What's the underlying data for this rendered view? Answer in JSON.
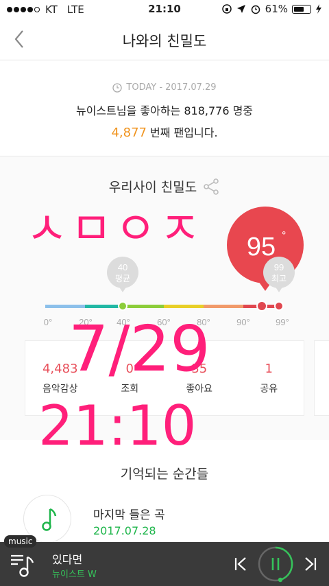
{
  "status_bar": {
    "carrier": "KT",
    "network": "LTE",
    "time": "21:10",
    "battery": "61%"
  },
  "nav": {
    "title": "나와의 친밀도"
  },
  "today": {
    "date_label": "TODAY - 2017.07.29",
    "line1": "뉴이스트님을 좋아하는 818,776 명중",
    "rank": "4,877",
    "rank_suffix": " 번째 팬입니다."
  },
  "intimacy": {
    "heading": "우리사이 친밀도",
    "my_score": "95",
    "my_score_degree": "°",
    "average": {
      "value": "40",
      "label": "평균"
    },
    "highest": {
      "value": "99",
      "label": "최고"
    },
    "scale_ticks": [
      "0°",
      "20°",
      "40°",
      "60°",
      "80°",
      "90°",
      "99°"
    ],
    "segment_colors": [
      "#8cc0ea",
      "#22b8a4",
      "#8ccd3a",
      "#e8cf27",
      "#f19a6a",
      "#e0474f"
    ],
    "stats": [
      {
        "value": "4,483",
        "label": "음악감상"
      },
      {
        "value": "0",
        "label": "조회"
      },
      {
        "value": "35",
        "label": "좋아요"
      },
      {
        "value": "1",
        "label": "공유"
      }
    ]
  },
  "moments": {
    "heading": "기억되는 순간들",
    "item_title": "마지막 들은 곡",
    "item_date": "2017.07.28"
  },
  "player": {
    "tag": "music",
    "song": "있다면",
    "artist": "뉴이스트 W"
  },
  "handwriting": {
    "line1": "ㅅㅁㅇㅈ",
    "line2": "7/29",
    "line3": "21:10",
    "color": "#ff1f7a"
  }
}
